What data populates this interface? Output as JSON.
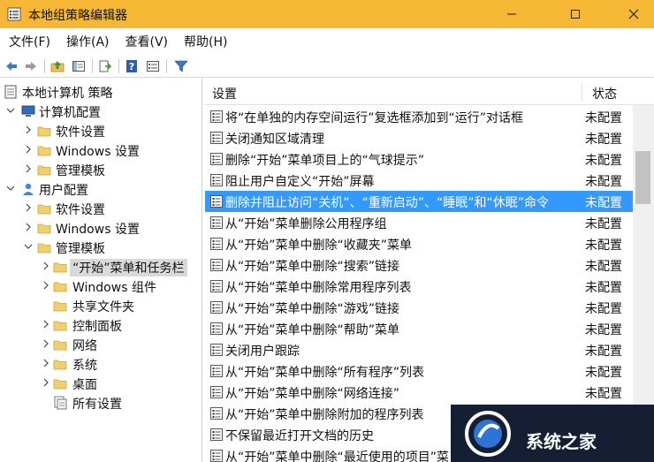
{
  "window": {
    "title": "本地组策略编辑器",
    "accent_color": "#f6b834"
  },
  "menu": [
    {
      "label": "文件(F)"
    },
    {
      "label": "操作(A)"
    },
    {
      "label": "查看(V)"
    },
    {
      "label": "帮助(H)"
    }
  ],
  "toolbar": {
    "icons": [
      "back-arrow-icon",
      "forward-arrow-icon",
      "up-folder-icon",
      "show-hide-tree-icon",
      "export-list-icon",
      "help-icon",
      "properties-icon",
      "filter-icon"
    ]
  },
  "tree": {
    "root": "本地计算机 策略",
    "computer_config": "计算机配置",
    "software_settings_1": "软件设置",
    "windows_settings_1": "Windows 设置",
    "admin_templates_1": "管理模板",
    "user_config": "用户配置",
    "software_settings_2": "软件设置",
    "windows_settings_2": "Windows 设置",
    "admin_templates_2": "管理模板",
    "start_menu_taskbar": "“开始”菜单和任务栏",
    "windows_components": "Windows 组件",
    "shared_folders": "共享文件夹",
    "control_panel": "控制面板",
    "network": "网络",
    "system": "系统",
    "desktop": "桌面",
    "all_settings": "所有设置"
  },
  "list": {
    "header_setting": "设置",
    "header_status": "状态",
    "selected_color": "#3399ff",
    "rows": [
      {
        "text": "将“在单独的内存空间运行”复选框添加到“运行”对话框",
        "status": "未配置"
      },
      {
        "text": "关闭通知区域清理",
        "status": "未配置"
      },
      {
        "text": "删除“开始”菜单项目上的“气球提示”",
        "status": "未配置"
      },
      {
        "text": "阻止用户自定义“开始”屏幕",
        "status": "未配置"
      },
      {
        "text": "删除并阻止访问“关机”、“重新启动”、“睡眠”和“休眠”命令",
        "status": "未配置"
      },
      {
        "text": "从“开始”菜单删除公用程序组",
        "status": "未配置"
      },
      {
        "text": "从“开始”菜单中删除“收藏夹”菜单",
        "status": "未配置"
      },
      {
        "text": "从“开始”菜单中删除“搜索”链接",
        "status": "未配置"
      },
      {
        "text": "从“开始”菜单中删除常用程序列表",
        "status": "未配置"
      },
      {
        "text": "从“开始”菜单中删除“游戏”链接",
        "status": "未配置"
      },
      {
        "text": "从“开始”菜单中删除“帮助”菜单",
        "status": "未配置"
      },
      {
        "text": "关闭用户跟踪",
        "status": "未配置"
      },
      {
        "text": "从“开始”菜单中删除“所有程序”列表",
        "status": "未配置"
      },
      {
        "text": "从“开始”菜单中删除“网络连接”",
        "status": "未配置"
      },
      {
        "text": "从“开始”菜单中删除附加的程序列表",
        "status": ""
      },
      {
        "text": "不保留最近打开文档的历史",
        "status": ""
      },
      {
        "text": "从“开始”菜单中删除“最近使用的项目”菜",
        "status": ""
      }
    ]
  },
  "watermark": {
    "text": "系统之家"
  }
}
